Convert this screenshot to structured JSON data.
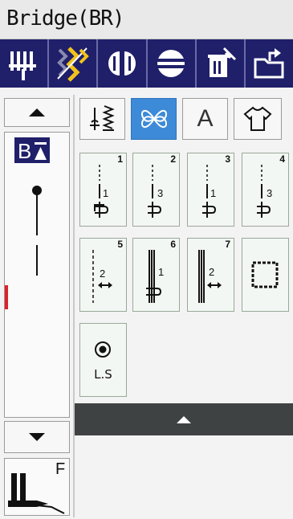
{
  "title": "Bridge(BR)",
  "toolbar": {
    "buttons": [
      {
        "name": "needle-position-icon"
      },
      {
        "name": "mirror-stitch-icon"
      },
      {
        "name": "elongation-icon"
      },
      {
        "name": "twin-needle-icon"
      },
      {
        "name": "delete-icon"
      },
      {
        "name": "save-icon"
      }
    ]
  },
  "tabs": [
    {
      "name": "utility-stitch-tab"
    },
    {
      "name": "decorative-stitch-tab",
      "active": true
    },
    {
      "name": "character-tab",
      "label": "A"
    },
    {
      "name": "garment-tab"
    }
  ],
  "left": {
    "badge_letter": "B",
    "foot_letter": "F",
    "marker_color": "#e0202a"
  },
  "stitches": [
    {
      "num": "1",
      "center": "1"
    },
    {
      "num": "2",
      "center": "3"
    },
    {
      "num": "3",
      "center": "1"
    },
    {
      "num": "4",
      "center": "3"
    },
    {
      "num": "5",
      "center": "2"
    },
    {
      "num": "6",
      "center": "1"
    },
    {
      "num": "7",
      "center": "2"
    },
    {
      "num": ""
    },
    {
      "num": "",
      "label": "L.S"
    }
  ],
  "colors": {
    "toolbar": "#1f1f6a",
    "active_tab": "#3d8ad8",
    "accent_yellow": "#f2c31b"
  }
}
